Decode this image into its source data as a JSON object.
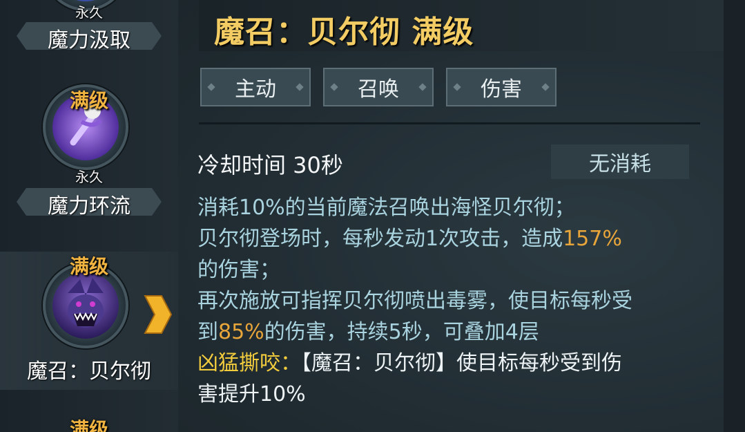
{
  "sidebar": {
    "skills": [
      {
        "permanent": "永久",
        "name": "魔力汲取"
      },
      {
        "badge": "满级",
        "permanent": "永久",
        "name": "魔力环流"
      },
      {
        "badge": "满级",
        "name": "魔召：贝尔彻",
        "selected": true
      },
      {
        "badge": "满级"
      }
    ]
  },
  "detail": {
    "title": "魔召：贝尔彻 满级",
    "tags": [
      "主动",
      "召唤",
      "伤害"
    ],
    "cooldown": "冷却时间 30秒",
    "cost": "无消耗",
    "desc": {
      "line1": "消耗10%的当前魔法召唤出海怪贝尔彻；",
      "line2_a": "贝尔彻登场时，每秒发动1次攻击，造成",
      "line2_hl": "157%",
      "line3": "的伤害；",
      "line4": "再次施放可指挥贝尔彻喷出毒雾，使目标每秒受",
      "line5_a": "到",
      "line5_hl": "85%",
      "line5_b": "的伤害，持续5秒，可叠加4层",
      "talent_label": "凶猛撕咬：",
      "talent_text_a": "【魔召：贝尔彻】使目标每秒受到伤",
      "talent_text_b": "害提升10%"
    }
  },
  "colors": {
    "title": "#f3cd64",
    "badge": "#f2b441",
    "highlight": "#e8a53a",
    "talent": "#f2cc3d",
    "desc": "#a9d3df"
  }
}
